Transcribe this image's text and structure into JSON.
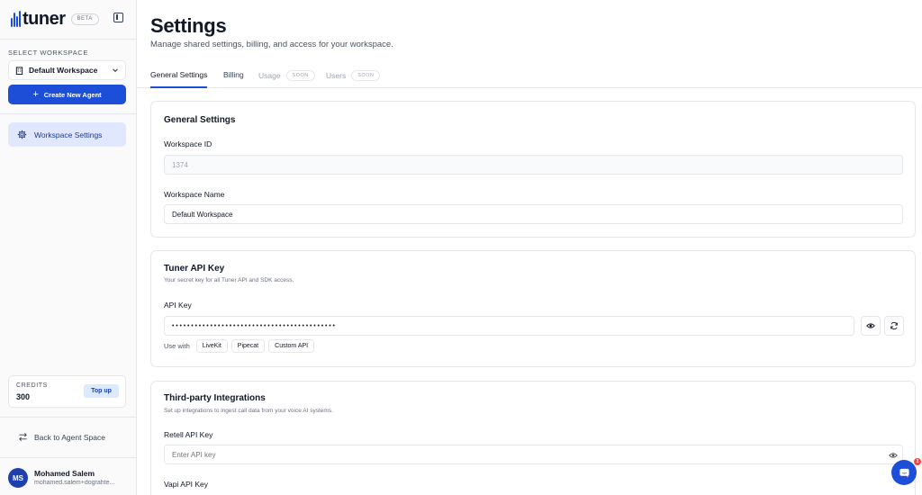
{
  "brand": {
    "name": "tuner",
    "badge": "BETA"
  },
  "sidebar": {
    "workspace_caption": "SELECT WORKSPACE",
    "workspace_name": "Default Workspace",
    "create_agent_label": "Create New Agent",
    "nav_items": [
      {
        "label": "Workspace Settings",
        "icon": "gear-icon",
        "active": true
      }
    ],
    "credits": {
      "caption": "CREDITS",
      "value": "300",
      "topup_label": "Top up"
    },
    "back_label": "Back to Agent Space",
    "user": {
      "initials": "MS",
      "name": "Mohamed Salem",
      "email": "mohamed.salem+dograhte..."
    }
  },
  "header": {
    "title": "Settings",
    "subtitle": "Manage shared settings, billing, and access for your workspace."
  },
  "tabs": [
    {
      "label": "General Settings",
      "active": true
    },
    {
      "label": "Billing"
    },
    {
      "label": "Usage",
      "badge": "SOON",
      "disabled": true
    },
    {
      "label": "Users",
      "badge": "SOON",
      "disabled": true
    }
  ],
  "general": {
    "title": "General Settings",
    "workspace_id_label": "Workspace ID",
    "workspace_id_value": "1374",
    "workspace_name_label": "Workspace Name",
    "workspace_name_value": "Default Workspace"
  },
  "api_key": {
    "title": "Tuner API Key",
    "description": "Your secret key for all Tuner API and SDK access.",
    "label": "API Key",
    "masked_value": "•••••••••••••••••••••••••••••••••••••••••••",
    "use_with_caption": "Use with",
    "integrations": [
      "LiveKit",
      "Pipecat",
      "Custom API"
    ]
  },
  "third_party": {
    "title": "Third-party Integrations",
    "description": "Set up integrations to ingest call data from your voice AI systems.",
    "retell_label": "Retell API Key",
    "retell_placeholder": "Enter API key",
    "vapi_label": "Vapi API Key"
  },
  "chat": {
    "badge": "1"
  },
  "colors": {
    "accent": "#1d4ed8",
    "nav_active_bg": "#e0e7ff",
    "badge_red": "#ef4444"
  }
}
